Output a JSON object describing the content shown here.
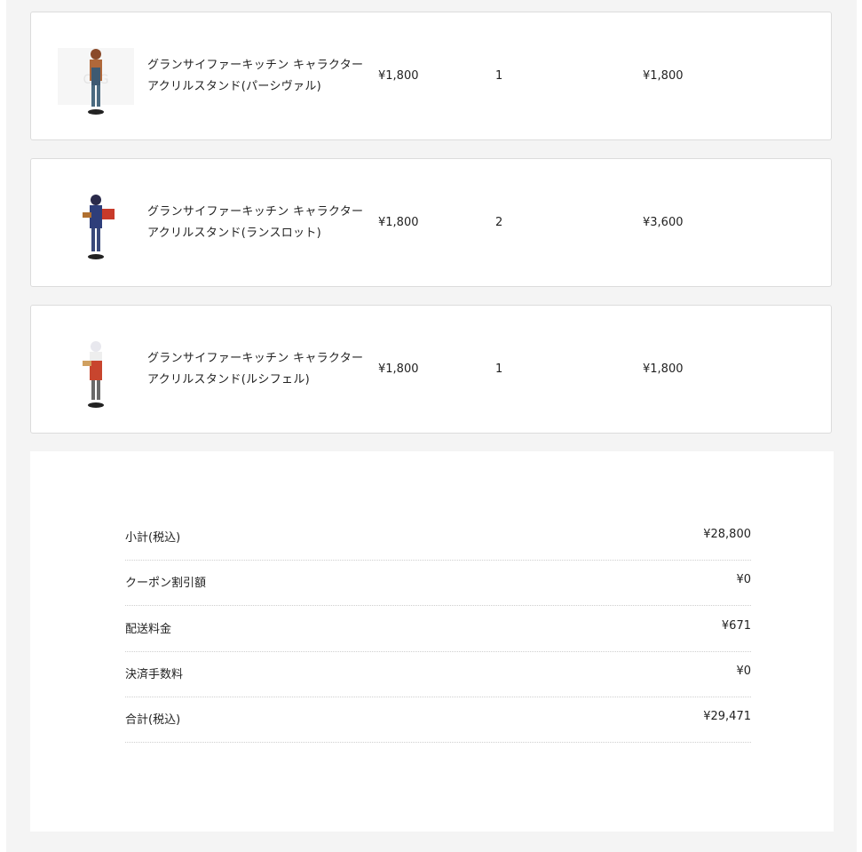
{
  "cart": {
    "items": [
      {
        "name_line1": "グランサイファーキッチン キャラクター",
        "name_line2": "アクリルスタンド(パーシヴァル)",
        "price": "¥1,800",
        "quantity": "1",
        "total": "¥1,800",
        "image_icon": "acrylic-stand-percival-icon",
        "accent": "#b0683a"
      },
      {
        "name_line1": "グランサイファーキッチン キャラクター",
        "name_line2": "アクリルスタンド(ランスロット)",
        "price": "¥1,800",
        "quantity": "2",
        "total": "¥3,600",
        "image_icon": "acrylic-stand-lancelot-icon",
        "accent": "#2e3e7a"
      },
      {
        "name_line1": "グランサイファーキッチン キャラクター",
        "name_line2": "アクリルスタンド(ルシフェル)",
        "price": "¥1,800",
        "quantity": "1",
        "total": "¥1,800",
        "image_icon": "acrylic-stand-lucifer-icon",
        "accent": "#c8452e"
      }
    ]
  },
  "summary": {
    "rows": [
      {
        "label": "小計(税込)",
        "value": "¥28,800"
      },
      {
        "label": "クーポン割引額",
        "value": "¥0"
      },
      {
        "label": "配送料金",
        "value": "¥671"
      },
      {
        "label": "決済手数料",
        "value": "¥0"
      },
      {
        "label": "合計(税込)",
        "value": "¥29,471"
      }
    ]
  }
}
